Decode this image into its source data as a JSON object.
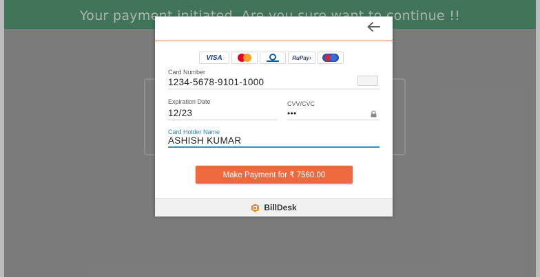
{
  "banner": {
    "text": "Your payment initiated. Are you sure want to continue !!"
  },
  "card_logos": [
    "visa-logo",
    "mastercard-logo",
    "diners-club-logo",
    "rupay-logo",
    "maestro-logo"
  ],
  "logo_text": {
    "visa": "VISA",
    "rupay": "RuPay›"
  },
  "form": {
    "card_number": {
      "label": "Card Number",
      "value": "1234-5678-9101-1000"
    },
    "expiration": {
      "label": "Expiration Date",
      "value": "12/23"
    },
    "cvv": {
      "label": "CVV/CVC",
      "value": "•••"
    },
    "holder": {
      "label": "Card Holder Name",
      "value": "ASHISH KUMAR"
    }
  },
  "pay_button_label": "Make Payment for ₹ 7560.00",
  "footer": {
    "brand": "BillDesk"
  },
  "colors": {
    "banner": "#3f9064",
    "accent": "#ee6a3e",
    "focus": "#2a86b4"
  }
}
